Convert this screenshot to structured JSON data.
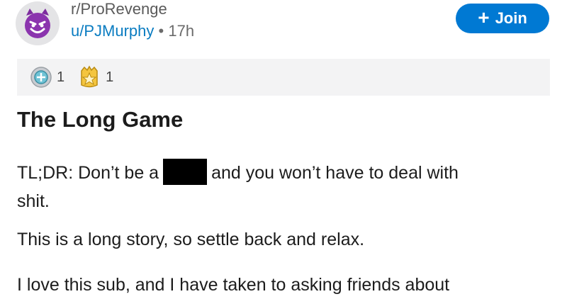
{
  "post": {
    "community": "r/ProRevenge",
    "user": "u/PJMurphy",
    "separator": "•",
    "time": "17h",
    "join_label": "Join",
    "join_icon": "plus-icon",
    "avatar_icon": "devil-face-icon",
    "awards": [
      {
        "icon": "helpful-award-icon",
        "count": "1"
      },
      {
        "icon": "wholesome-award-icon",
        "count": "1"
      }
    ],
    "title": "The Long Game",
    "paragraphs": {
      "p1_a": "TL;DR: Don’t be a",
      "p1_b": "and you won’t have to deal with",
      "p1_c": "shit.",
      "p2": "This is a long story, so settle back and relax.",
      "p3": "I love this sub, and I have taken to asking friends about"
    }
  },
  "colors": {
    "accent": "#0079d3",
    "username": "#0a7cc1",
    "avatar_purple": "#7d2c9e"
  }
}
